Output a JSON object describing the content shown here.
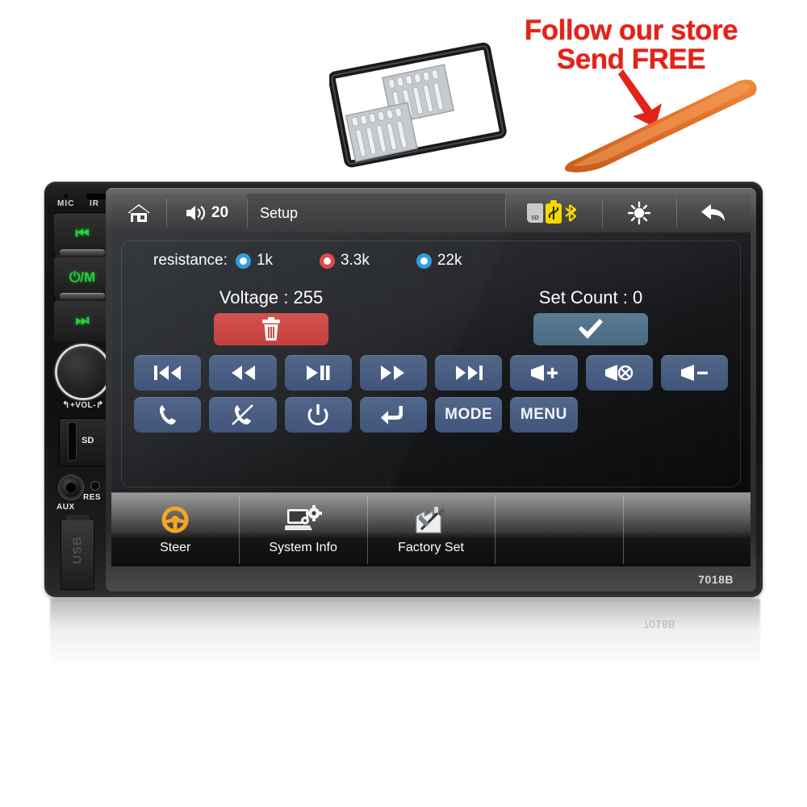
{
  "promo": {
    "line1": "Follow our store",
    "line2": "Send FREE",
    "color": "#e2231a",
    "arrow_icon": "red-down-arrow-icon"
  },
  "accessories": {
    "trim_frame": "mounting-trim-frame",
    "brackets": "mounting-brackets",
    "pry_tool": "orange-pry-tool"
  },
  "device": {
    "model": "7018B",
    "reflection_label": "7018B",
    "left_panel": {
      "mic_label": "MIC",
      "ir_label": "IR",
      "buttons": [
        {
          "name": "prev-track-button",
          "glyph": "⏮"
        },
        {
          "name": "power-mode-button",
          "glyph": "⏻/M"
        },
        {
          "name": "next-track-button",
          "glyph": "⏭"
        }
      ],
      "knob_label": "+VOL-",
      "sd_label": "SD",
      "aux_label": "AUX",
      "res_label": "RES",
      "usb_label": "USB"
    }
  },
  "screen": {
    "topbar": {
      "home_icon": "home-icon",
      "volume_icon": "speaker-icon",
      "volume_value": "20",
      "title": "Setup",
      "status_icons": [
        "sd-card-icon",
        "usb-icon",
        "bluetooth-icon"
      ],
      "sd_chip_label": "SD",
      "brightness_icon": "brightness-sun-icon",
      "back_icon": "back-arrow-icon"
    },
    "resistance": {
      "label": "resistance:",
      "options": [
        {
          "label": "1k",
          "color": "#2f9fe0"
        },
        {
          "label": "3.3k",
          "color": "#e1484f"
        },
        {
          "label": "22k",
          "color": "#2f9fe0"
        }
      ]
    },
    "readouts": [
      {
        "name": "voltage-readout",
        "text": "Voltage : 255"
      },
      {
        "name": "set-count-readout",
        "text": "Set Count : 0"
      }
    ],
    "action_buttons": [
      {
        "name": "delete-button",
        "icon": "trash-icon",
        "color": "#c4413d"
      },
      {
        "name": "confirm-button",
        "icon": "check-icon",
        "color": "#4a6b82"
      }
    ],
    "keypad": [
      {
        "name": "previous-button",
        "icon": "skip-back-icon",
        "label": ""
      },
      {
        "name": "rewind-button",
        "icon": "rewind-icon",
        "label": ""
      },
      {
        "name": "play-pause-button",
        "icon": "play-pause-icon",
        "label": ""
      },
      {
        "name": "fast-forward-button",
        "icon": "fast-forward-icon",
        "label": ""
      },
      {
        "name": "next-button",
        "icon": "skip-forward-icon",
        "label": ""
      },
      {
        "name": "volume-up-button",
        "icon": "volume-up-icon",
        "label": ""
      },
      {
        "name": "mute-button",
        "icon": "volume-mute-icon",
        "label": ""
      },
      {
        "name": "volume-down-button",
        "icon": "volume-down-icon",
        "label": ""
      },
      {
        "name": "answer-call-button",
        "icon": "phone-icon",
        "label": ""
      },
      {
        "name": "end-call-button",
        "icon": "phone-hangup-icon",
        "label": ""
      },
      {
        "name": "power-button",
        "icon": "power-icon",
        "label": ""
      },
      {
        "name": "enter-button",
        "icon": "enter-arrow-icon",
        "label": ""
      },
      {
        "name": "mode-button",
        "icon": "",
        "label": "MODE"
      },
      {
        "name": "menu-button",
        "icon": "",
        "label": "MENU"
      }
    ],
    "tabs": [
      {
        "name": "tab-steer",
        "label": "Steer",
        "icon": "steering-wheel-icon"
      },
      {
        "name": "tab-system-info",
        "label": "System Info",
        "icon": "laptop-gear-icon"
      },
      {
        "name": "tab-factory-set",
        "label": "Factory Set",
        "icon": "factory-tools-icon"
      },
      {
        "name": "tab-empty-1",
        "label": "",
        "icon": ""
      },
      {
        "name": "tab-empty-2",
        "label": "",
        "icon": ""
      }
    ]
  }
}
